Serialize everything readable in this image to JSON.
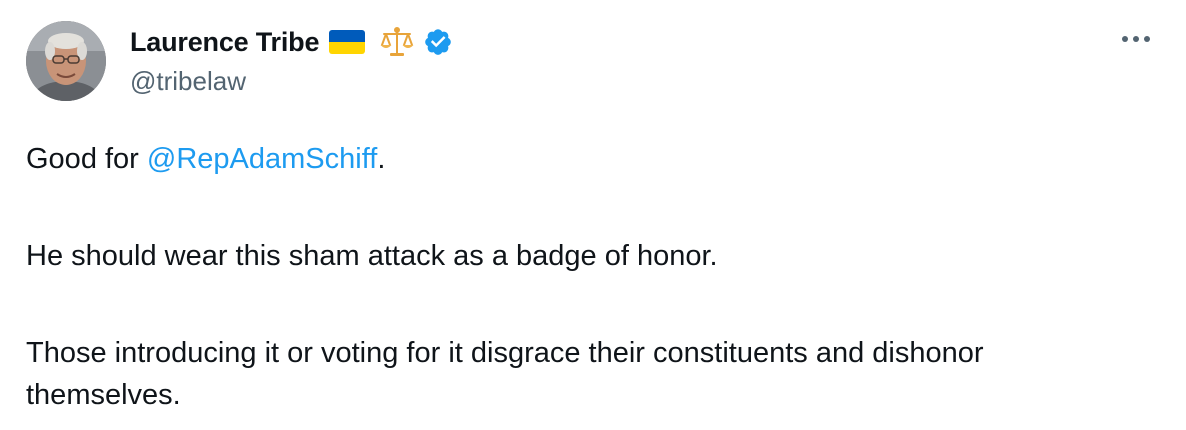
{
  "author": {
    "display_name": "Laurence Tribe",
    "handle": "@tribelaw",
    "flag_emoji": "ukraine-flag",
    "scales_emoji": "balance-scale",
    "verified": true
  },
  "tweet": {
    "line1_prefix": "Good for ",
    "line1_mention": "@RepAdamSchiff",
    "line1_suffix": ".",
    "paragraph2": "He should wear this sham attack as a badge of honor.",
    "paragraph3": "Those introducing it or voting for it disgrace their constituents and dishonor themselves."
  },
  "colors": {
    "text": "#0f1419",
    "secondary": "#536471",
    "link": "#1d9bf0",
    "verified": "#1d9bf0",
    "flag_blue": "#005bbb",
    "flag_yellow": "#ffd500"
  },
  "icons": {
    "more": "more-horizontal-icon"
  }
}
